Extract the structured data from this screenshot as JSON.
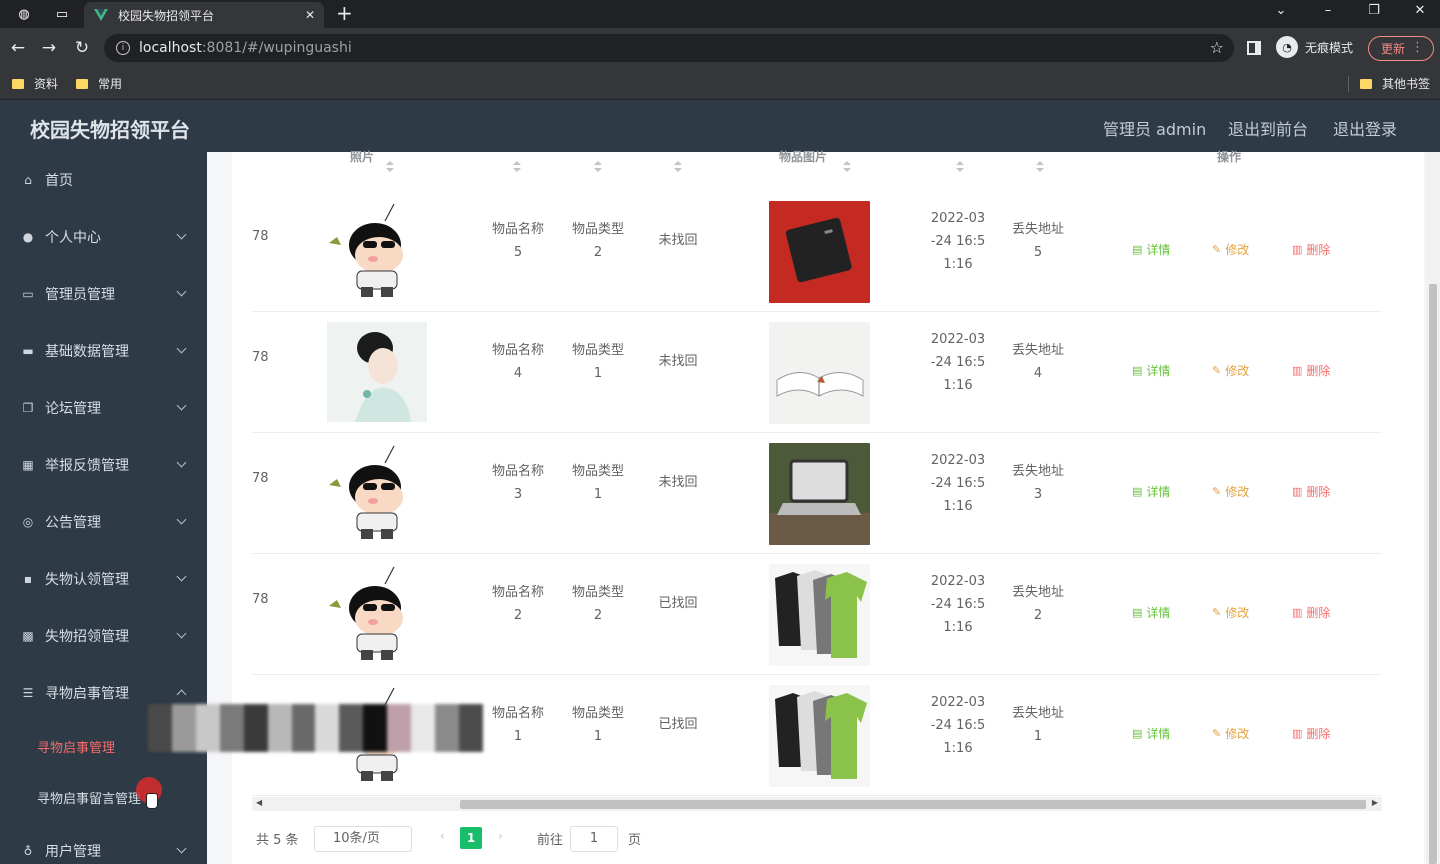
{
  "browser": {
    "tab_title": "校园失物招领平台",
    "url_host": "localhost",
    "url_rest": ":8081/#/wupinguashi",
    "incognito_label": "无痕模式",
    "update_label": "更新",
    "bookmarks": [
      "资料",
      "常用"
    ],
    "other_bookmarks": "其他书签"
  },
  "header": {
    "title": "校园失物招领平台",
    "admin": "管理员 admin",
    "to_front": "退出到前台",
    "logout": "退出登录"
  },
  "sidebar": {
    "items": [
      {
        "label": "首页",
        "icon": "home-icon"
      },
      {
        "label": "个人中心",
        "icon": "user-icon"
      },
      {
        "label": "管理员管理",
        "icon": "message-icon"
      },
      {
        "label": "基础数据管理",
        "icon": "suitcase-icon"
      },
      {
        "label": "论坛管理",
        "icon": "copy-icon"
      },
      {
        "label": "举报反馈管理",
        "icon": "chart-icon"
      },
      {
        "label": "公告管理",
        "icon": "compass-icon"
      },
      {
        "label": "失物认领管理",
        "icon": "chat-icon"
      },
      {
        "label": "失物招领管理",
        "icon": "film-icon"
      },
      {
        "label": "寻物启事管理",
        "icon": "sliders-icon"
      }
    ],
    "submenu": [
      "寻物启事管理",
      "寻物启事留言管理"
    ],
    "last_item": {
      "label": "用户管理",
      "icon": "mic-icon"
    }
  },
  "table": {
    "headers": {
      "photo": "照片",
      "item_photo": "物品图片",
      "ops": "操作"
    },
    "id_fragment": "78",
    "rows": [
      {
        "name": "物品名称\n5",
        "type": "物品类型\n2",
        "status": "未找回",
        "date": "2022-03\n-24 16:5\n1:16",
        "addr": "丢失地址\n5"
      },
      {
        "name": "物品名称\n4",
        "type": "物品类型\n1",
        "status": "未找回",
        "date": "2022-03\n-24 16:5\n1:16",
        "addr": "丢失地址\n4"
      },
      {
        "name": "物品名称\n3",
        "type": "物品类型\n1",
        "status": "未找回",
        "date": "2022-03\n-24 16:5\n1:16",
        "addr": "丢失地址\n3"
      },
      {
        "name": "物品名称\n2",
        "type": "物品类型\n2",
        "status": "已找回",
        "date": "2022-03\n-24 16:5\n1:16",
        "addr": "丢失地址\n2"
      },
      {
        "name": "物品名称\n1",
        "type": "物品类型\n1",
        "status": "已找回",
        "date": "2022-03\n-24 16:5\n1:16",
        "addr": "丢失地址\n1"
      }
    ],
    "actions": {
      "detail": "详情",
      "edit": "修改",
      "delete": "删除"
    }
  },
  "pagination": {
    "total": "共 5 条",
    "page_size": "10条/页",
    "current": "1",
    "goto": "前往",
    "goto_value": "1",
    "page_suffix": "页"
  },
  "colors": {
    "sidebar_bg": "#2e3a46",
    "active_menu": "#f56c6c",
    "detail": "#67c23a",
    "edit": "#e6a23c",
    "delete": "#f56c6c",
    "pager_active": "#19be6b"
  }
}
